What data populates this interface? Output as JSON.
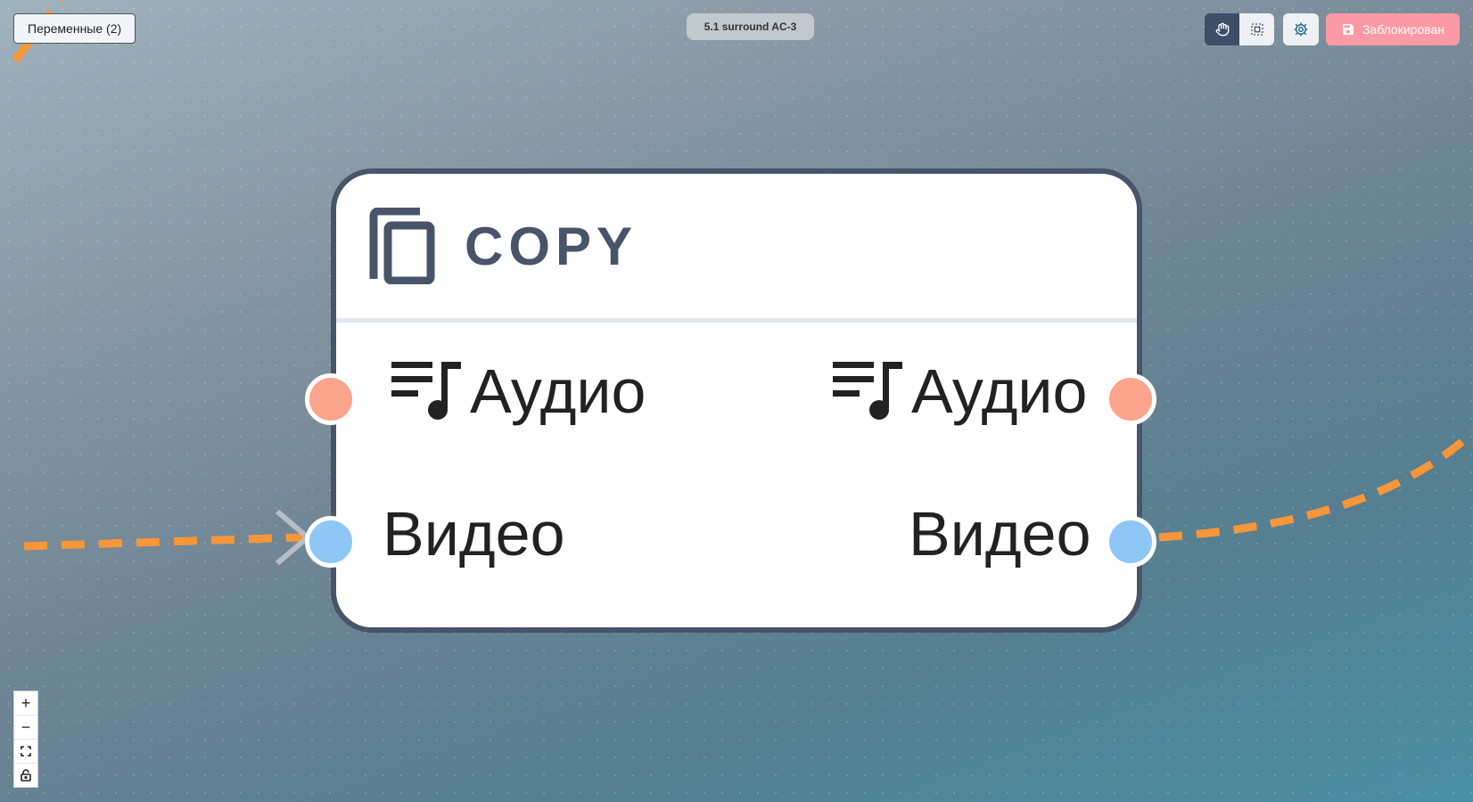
{
  "toolbar": {
    "variables_label": "Переменные (2)",
    "title": "5.1 surround AC-3",
    "lock_label": "Заблокирован",
    "tools": [
      {
        "name": "hand-tool",
        "icon": "hand-icon",
        "active": true
      },
      {
        "name": "select-tool",
        "icon": "selection-icon",
        "active": false
      }
    ],
    "settings_icon": "gear-icon"
  },
  "node": {
    "icon": "copy-icon",
    "title": "COPY",
    "inputs": [
      {
        "label": "Аудио",
        "type": "audio",
        "icon": "music-list-icon"
      },
      {
        "label": "Видео",
        "type": "video"
      }
    ],
    "outputs": [
      {
        "label": "Аудио",
        "type": "audio",
        "icon": "music-list-icon"
      },
      {
        "label": "Видео",
        "type": "video"
      }
    ]
  },
  "controls": {
    "zoom_in": "+",
    "zoom_out": "−",
    "fit_view_icon": "fit-view-icon",
    "lock_icon": "unlock-icon"
  },
  "colors": {
    "edge": "#f7963a",
    "audio_port": "#fca48c",
    "video_port": "#8ec7f6",
    "node_border": "#48546a",
    "lock_button": "#f99aa6"
  }
}
